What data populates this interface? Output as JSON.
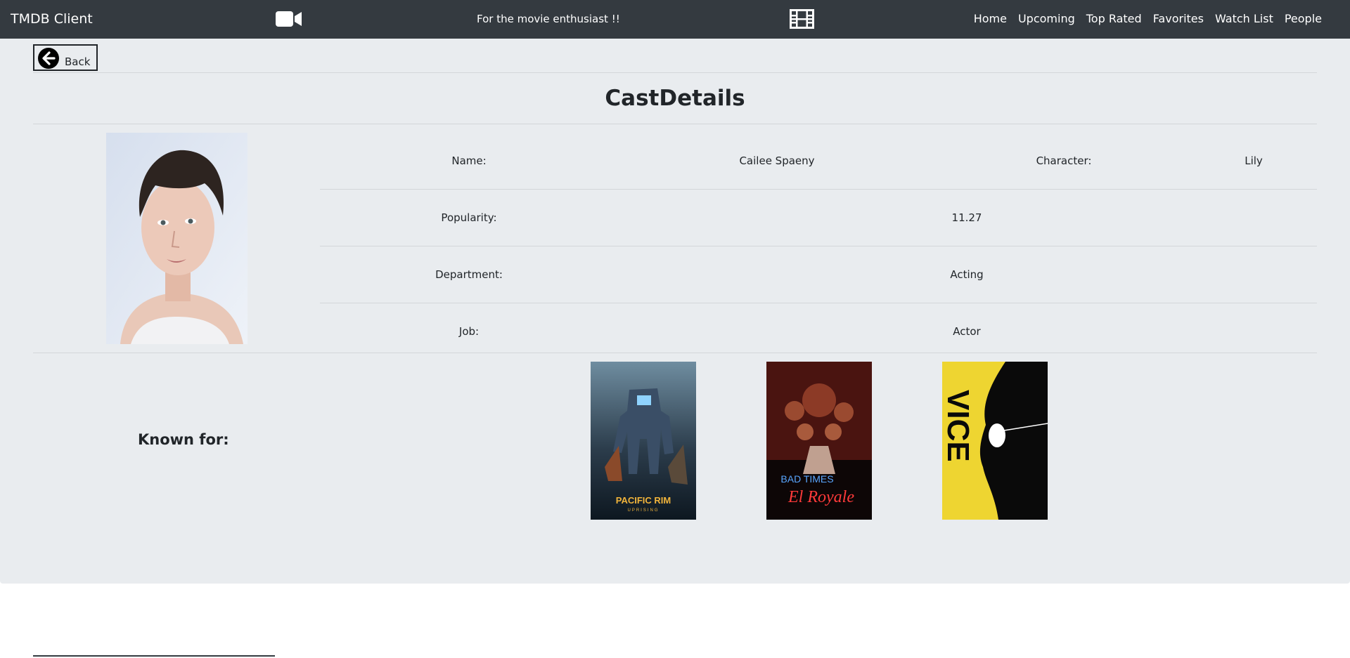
{
  "navbar": {
    "brand": "TMDB Client",
    "tagline": "For the movie enthusiast !!",
    "links": [
      "Home",
      "Upcoming",
      "Top Rated",
      "Favorites",
      "Watch List",
      "People"
    ],
    "icons": [
      "video-camera-icon",
      "film-icon"
    ]
  },
  "back_button": {
    "label": "Back",
    "icon": "arrow-left-circle-icon"
  },
  "page_title": "CastDetails",
  "details": {
    "name_label": "Name:",
    "name_value": "Cailee Spaeny",
    "character_label": "Character:",
    "character_value": "Lily",
    "popularity_label": "Popularity:",
    "popularity_value": "11.27",
    "department_label": "Department:",
    "department_value": "Acting",
    "job_label": "Job:",
    "job_value": "Actor"
  },
  "known_for": {
    "label": "Known for:",
    "posters": [
      {
        "title_text": "PACIFIC RIM",
        "subtitle_text": "UPRISING"
      },
      {
        "title_text": "BAD TIMES",
        "subtitle_text": "El Royale"
      },
      {
        "title_text": "VICE"
      }
    ]
  },
  "colors": {
    "navbar_bg": "#343a40",
    "content_bg": "#e9ecef",
    "text": "#212529"
  }
}
